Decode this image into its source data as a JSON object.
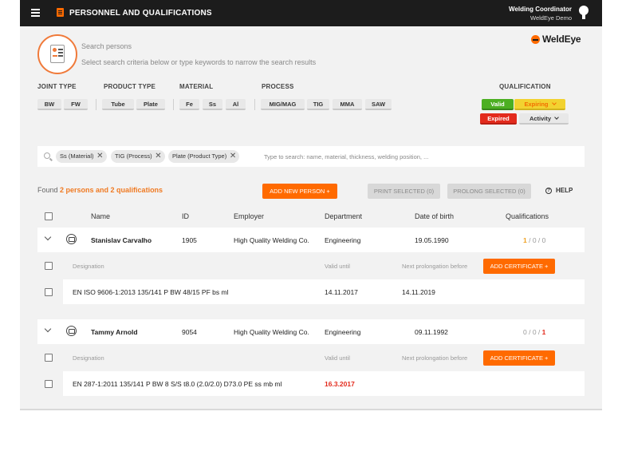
{
  "header": {
    "title": "PERSONNEL AND QUALIFICATIONS",
    "user_role": "Welding Coordinator",
    "user_org": "WeldEye Demo"
  },
  "search": {
    "title": "Search persons",
    "subtitle": "Select search criteria below or type keywords to narrow the search results",
    "placeholder": "Type to search: name, material, thickness, welding position, ...",
    "tags": [
      "Ss (Material)",
      "TIG (Process)",
      "Plate (Product Type)"
    ]
  },
  "logo": {
    "text": "WeldEye"
  },
  "filters": {
    "joint_type": {
      "label": "JOINT TYPE",
      "options": [
        "BW",
        "FW"
      ]
    },
    "product_type": {
      "label": "PRODUCT TYPE",
      "options": [
        "Tube",
        "Plate"
      ]
    },
    "material": {
      "label": "MATERIAL",
      "options": [
        "Fe",
        "Ss",
        "Al"
      ]
    },
    "process": {
      "label": "PROCESS",
      "options": [
        "MIG/MAG",
        "TIG",
        "MMA",
        "SAW"
      ]
    },
    "qualification": {
      "label": "QUALIFICATION",
      "valid": "Valid",
      "expiring": "Expiring",
      "expired": "Expired",
      "activity": "Activity"
    }
  },
  "results": {
    "prefix": "Found ",
    "summary": "2 persons and 2 qualifications",
    "add_person": "ADD NEW PERSON +",
    "print_selected": "PRINT SELECTED (0)",
    "prolong_selected": "PROLONG SELECTED (0)",
    "help": "HELP"
  },
  "table": {
    "columns": [
      "Name",
      "ID",
      "Employer",
      "Department",
      "Date of birth",
      "Qualifications"
    ],
    "sub_columns": {
      "designation": "Designation",
      "valid_until": "Valid until",
      "next_prolongation": "Next prolongation before",
      "add_certificate": "ADD CERTIFICATE +"
    },
    "persons": [
      {
        "name": "Stanislav Carvalho",
        "id": "1905",
        "employer": "High Quality Welding Co.",
        "department": "Engineering",
        "dob": "19.05.1990",
        "q_valid": "1",
        "q_sep1": " / ",
        "q_mid": "0",
        "q_sep2": " / ",
        "q_last": "0",
        "cert": {
          "designation": "EN ISO 9606-1:2013 135/141 P BW 48/15 PF bs ml",
          "valid_until": "14.11.2017",
          "next_prolongation": "14.11.2019"
        }
      },
      {
        "name": "Tammy Arnold",
        "id": "9054",
        "employer": "High Quality Welding Co.",
        "department": "Engineering",
        "dob": "09.11.1992",
        "q_valid": "0",
        "q_sep1": " / ",
        "q_mid": "0",
        "q_sep2": " / ",
        "q_last": "1",
        "cert": {
          "designation": "EN 287-1:2011 135/141 P BW 8 S/S t8.0 (2.0/2.0) D73.0 PE ss mb ml",
          "valid_until": "16.3.2017",
          "next_prolongation": ""
        }
      }
    ]
  },
  "colors": {
    "accent": "#ff6a00",
    "valid": "#4caf22",
    "expiring": "#f2d230",
    "expired": "#e32b1d",
    "topbar": "#1c1c1c"
  }
}
